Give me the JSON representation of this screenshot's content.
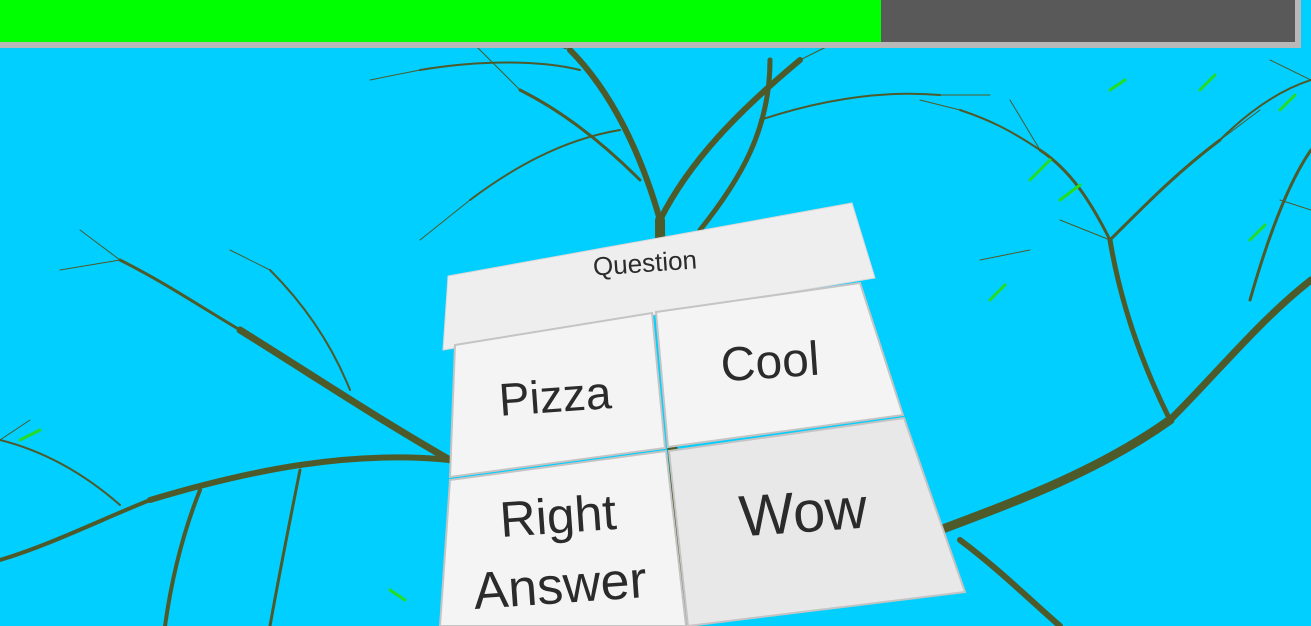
{
  "hud": {
    "progress": 0.68,
    "fill_color": "#00ff00",
    "track_color": "#595959"
  },
  "scene": {
    "sky_color": "#00cfff"
  },
  "quiz": {
    "question_label": "Question",
    "answers": [
      {
        "label": "Pizza"
      },
      {
        "label": "Cool"
      },
      {
        "label_line1": "Right",
        "label_line2": "Answer"
      },
      {
        "label": "Wow"
      }
    ]
  }
}
